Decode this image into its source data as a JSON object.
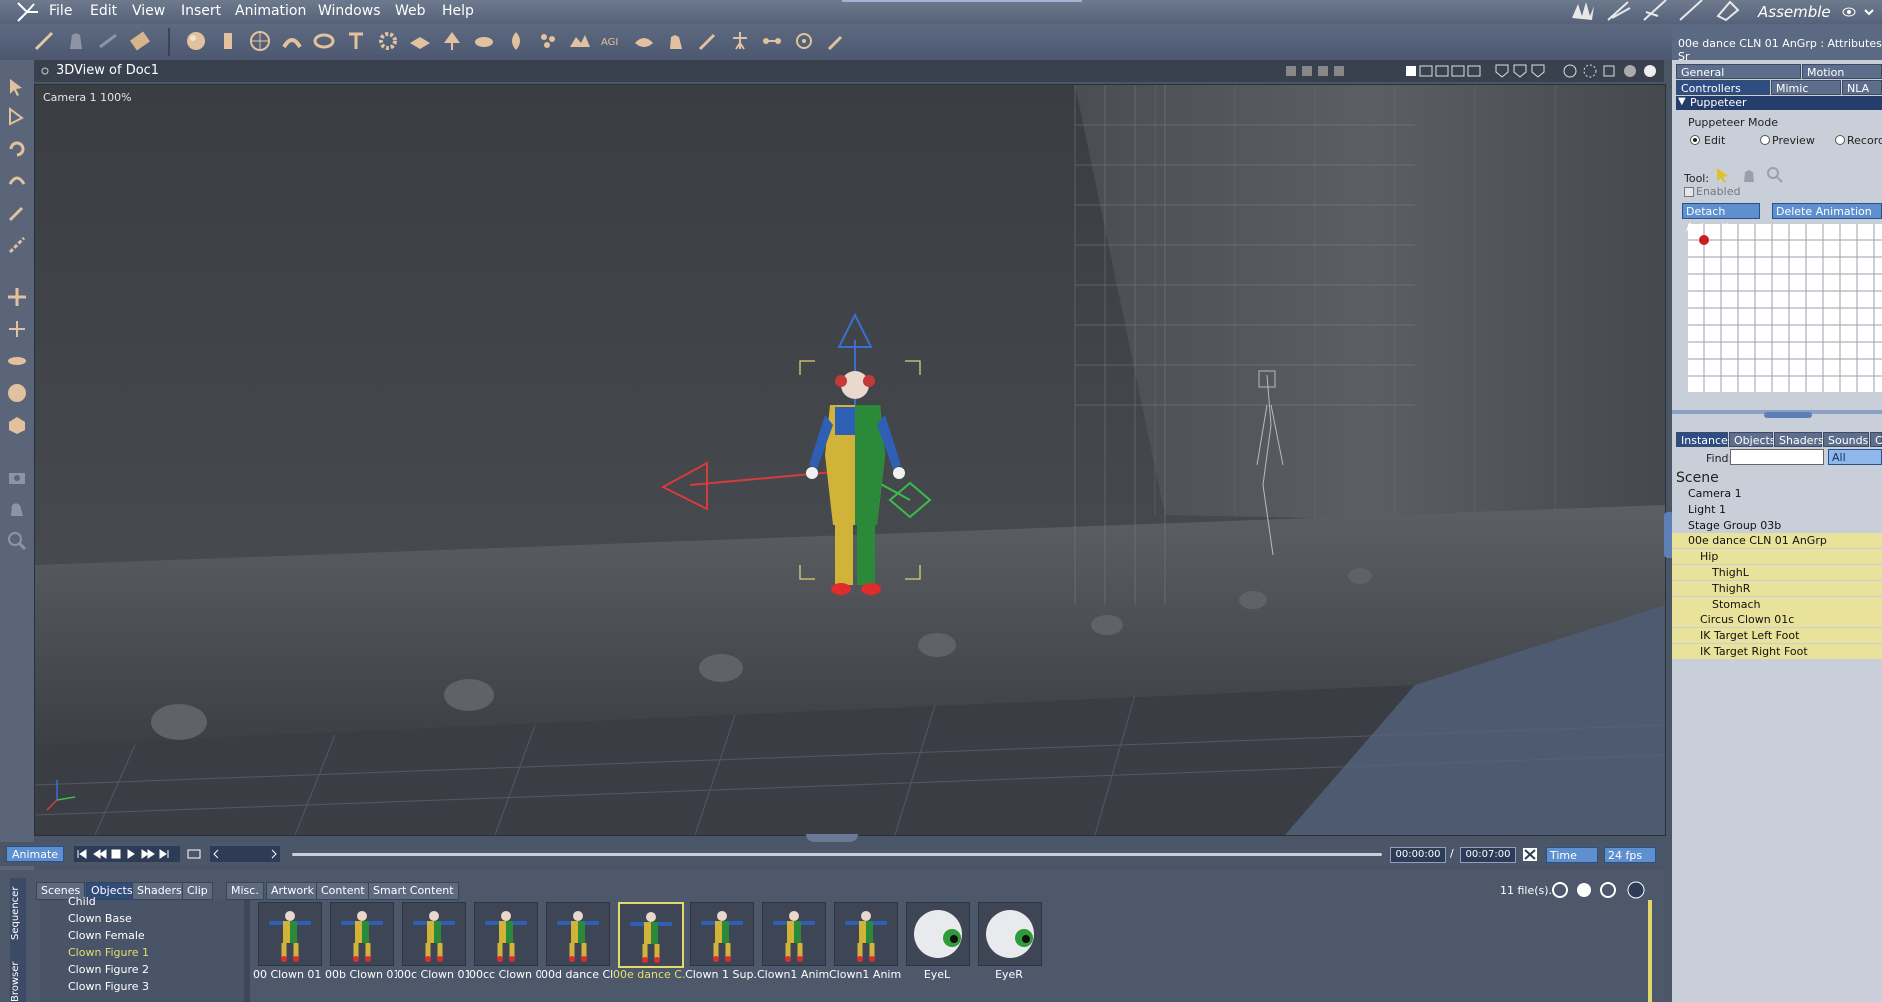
{
  "menubar": {
    "items": [
      "File",
      "Edit",
      "View",
      "Insert",
      "Animation",
      "Windows",
      "Web",
      "Help"
    ],
    "room_label": "Assemble"
  },
  "viewport": {
    "title": "3DView of Doc1",
    "camera_label": "Camera 1 100%"
  },
  "right_panel": {
    "title": "00e dance CLN 01 AnGrp : Attributes Sr",
    "tabs_row1": [
      "General",
      "Motion"
    ],
    "tabs_row2": [
      "Controllers",
      "Mimic",
      "NLA"
    ],
    "section": "Puppeteer",
    "mode_label": "Puppeteer Mode",
    "modes": [
      "Edit",
      "Preview",
      "Record"
    ],
    "tool_label": "Tool:",
    "enabled_label": "Enabled",
    "detach_button": "Detach Animation",
    "delete_button": "Delete Animation",
    "browser_tabs": [
      "Instances",
      "Objects",
      "Shaders",
      "Sounds",
      "C"
    ],
    "find_label": "Find:",
    "find_value": "",
    "filter_value": "All",
    "scene_header": "Scene",
    "tree": [
      {
        "label": "Camera 1",
        "indent": 0,
        "selected": false
      },
      {
        "label": "Light 1",
        "indent": 0,
        "selected": false
      },
      {
        "label": "Stage Group 03b",
        "indent": 0,
        "selected": false
      },
      {
        "label": "00e dance CLN 01 AnGrp",
        "indent": 0,
        "selected": true
      },
      {
        "label": "Hip",
        "indent": 1,
        "selected": true
      },
      {
        "label": "ThighL",
        "indent": 2,
        "selected": true
      },
      {
        "label": "ThighR",
        "indent": 2,
        "selected": true
      },
      {
        "label": "Stomach",
        "indent": 2,
        "selected": true
      },
      {
        "label": "Circus Clown 01c",
        "indent": 1,
        "selected": true
      },
      {
        "label": "IK Target Left Foot",
        "indent": 1,
        "selected": true
      },
      {
        "label": "IK Target Right Foot",
        "indent": 1,
        "selected": true
      }
    ]
  },
  "timeline": {
    "animate_button": "Animate",
    "current_time": "00:00:00",
    "separator": "/",
    "total_time": "00:07:00",
    "time_mode": "Time",
    "fps": "24 fps"
  },
  "browser": {
    "side_tabs": [
      "Sequencer",
      "Browser"
    ],
    "tabs": [
      "Scenes",
      "Objects",
      "Shaders",
      "Clip",
      "Misc.",
      "Artwork",
      "Content",
      "Smart Content"
    ],
    "active_tab": "Objects",
    "file_count": "11 file(s).",
    "list": [
      "Child",
      "Clown Base",
      "Clown Female",
      "Clown Figure 1",
      "Clown Figure 2",
      "Clown Figure 3"
    ],
    "selected_list_item": "Clown Figure 1",
    "thumbnails": [
      {
        "label": "00 Clown 01 .",
        "kind": "clown",
        "selected": false
      },
      {
        "label": "00b Clown 01.",
        "kind": "clown",
        "selected": false
      },
      {
        "label": "00c Clown 01.",
        "kind": "clown",
        "selected": false
      },
      {
        "label": "00cc Clown 0.",
        "kind": "clown",
        "selected": false
      },
      {
        "label": "00d dance Cl.",
        "kind": "clown",
        "selected": false
      },
      {
        "label": "00e dance C.",
        "kind": "clown",
        "selected": true
      },
      {
        "label": "Clown 1 Sup.",
        "kind": "clown",
        "selected": false
      },
      {
        "label": "Clown1 Anim .",
        "kind": "clown",
        "selected": false
      },
      {
        "label": "Clown1 Anim .",
        "kind": "clown",
        "selected": false
      },
      {
        "label": "EyeL",
        "kind": "eye",
        "selected": false
      },
      {
        "label": "EyeR",
        "kind": "eye",
        "selected": false
      }
    ]
  },
  "colors": {
    "selection_yellow": "#e9e29b",
    "accent_blue": "#2e4d82",
    "viewport_bg": "#3f4247"
  }
}
